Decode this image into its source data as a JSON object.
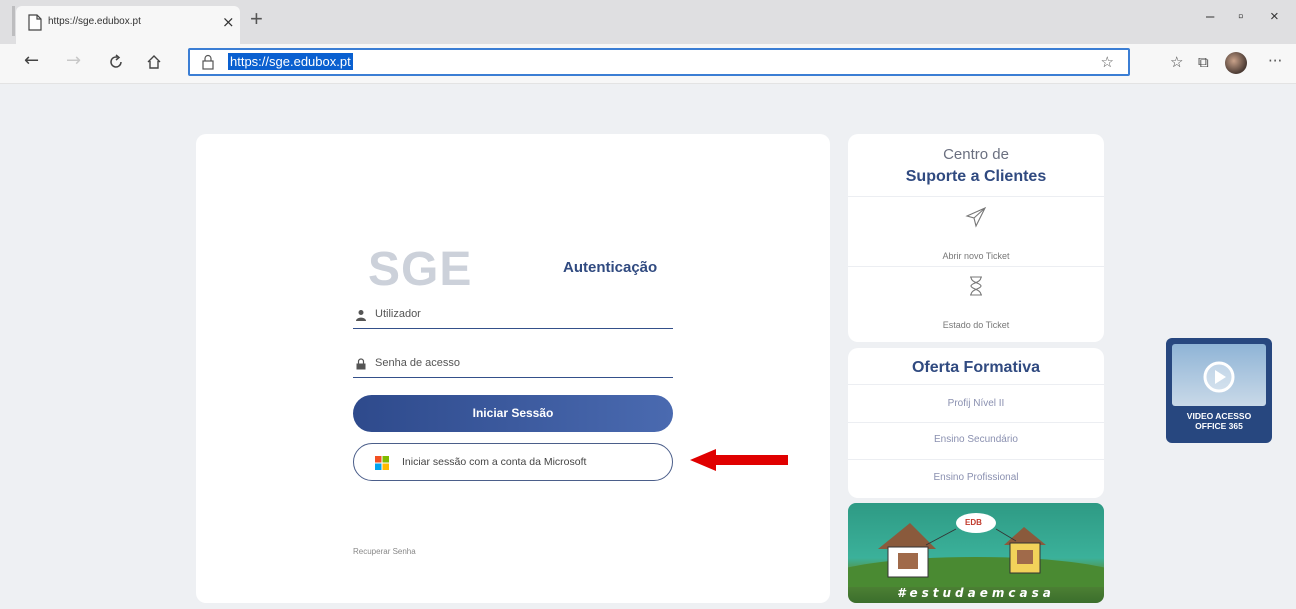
{
  "browser": {
    "tab_title": "https://sge.edubox.pt",
    "tab_close": "×",
    "new_tab": "+",
    "url": "https://sge.edubox.pt",
    "window_controls": {
      "minimize": "–",
      "maximize": "▫",
      "close": "×"
    },
    "more_label": "···"
  },
  "login": {
    "logo": "SGE",
    "title": "Autenticação",
    "username_placeholder": "Utilizador",
    "password_placeholder": "Senha de acesso",
    "login_button": "Iniciar Sessão",
    "microsoft_button": "Iniciar sessão com a conta da Microsoft",
    "recover_password": "Recuperar Senha"
  },
  "support": {
    "title_line1": "Centro de",
    "title_line2": "Suporte a Clientes",
    "items": [
      {
        "label": "Abrir novo Ticket",
        "icon": "paper-plane-icon"
      },
      {
        "label": "Estado do Ticket",
        "icon": "hourglass-icon"
      }
    ]
  },
  "offer": {
    "title": "Oferta Formativa",
    "items": [
      "Profij Nível II",
      "Ensino Secundário",
      "Ensino Profissional"
    ]
  },
  "banner": {
    "badge": "EDB",
    "hashtag": "#estudaemcasa"
  },
  "video": {
    "title_line1": "VIDEO ACESSO",
    "title_line2": "OFFICE 365"
  },
  "colors": {
    "brand_blue": "#304a80",
    "annotation_arrow": "#e00000",
    "address_highlight": "#0a60d0"
  }
}
